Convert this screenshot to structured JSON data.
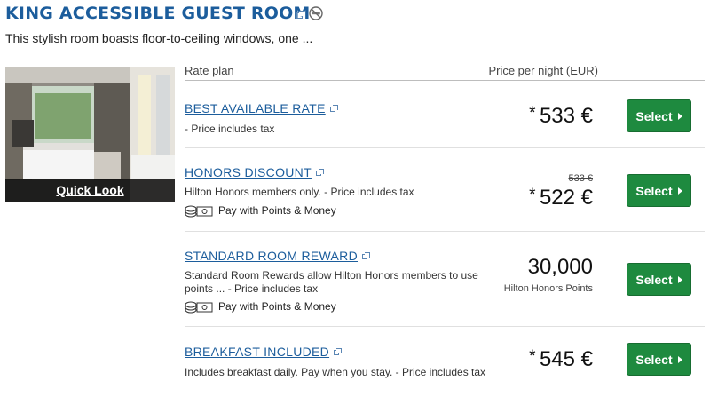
{
  "room": {
    "title": "KING ACCESSIBLE GUEST ROOM",
    "description": "This stylish room boasts floor-to-ceiling windows, one ..."
  },
  "quick_look": "Quick Look",
  "table_header": {
    "rate_plan": "Rate plan",
    "price_per_night": "Price per night (EUR)"
  },
  "rates": [
    {
      "name": "BEST AVAILABLE RATE",
      "description": "- Price includes tax",
      "price": "533 €",
      "star": "*",
      "select_label": "Select"
    },
    {
      "name": "HONORS DISCOUNT",
      "description": "Hilton Honors members only. - Price includes tax",
      "points_money": "Pay with Points & Money",
      "original_price": "533 €",
      "price": "522 €",
      "star": "*",
      "select_label": "Select"
    },
    {
      "name": "STANDARD ROOM REWARD",
      "description": "Standard Room Rewards allow Hilton Honors members to use points ... - Price includes tax",
      "points_money": "Pay with Points & Money",
      "price": "30,000",
      "price_unit": "Hilton Honors Points",
      "select_label": "Select"
    },
    {
      "name": "BREAKFAST INCLUDED",
      "description": "Includes breakfast daily. Pay when you stay. - Price includes tax",
      "price": "545 €",
      "star": "*",
      "select_label": "Select"
    }
  ],
  "icons": {
    "external": "external-link-icon",
    "no_smoking": "no-smoking-icon",
    "points_money": "points-money-icon",
    "arrow": "chevron-right-icon"
  },
  "colors": {
    "link": "#1c5d9c",
    "select_button": "#1e8a3f"
  }
}
